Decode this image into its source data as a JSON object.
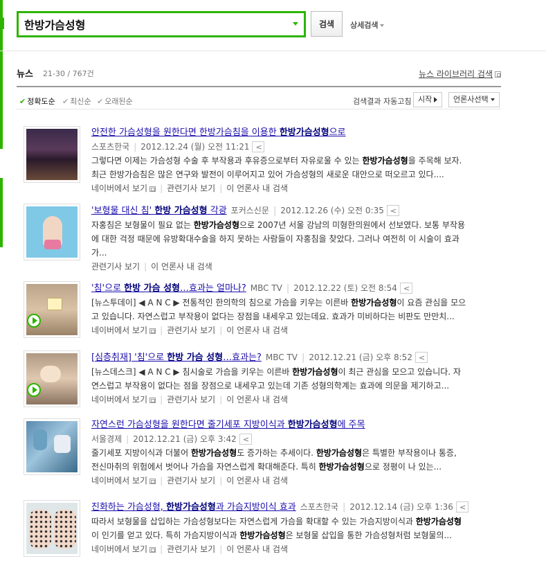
{
  "header": {
    "query": "한방가슴성형",
    "search_button": "검색",
    "advanced_search": "상세검색"
  },
  "section": {
    "title": "뉴스",
    "count": "21-30 / 767건",
    "library_link": "뉴스 라이브러리 검색"
  },
  "sort": {
    "options": [
      "정확도순",
      "최신순",
      "오래된순"
    ],
    "auto_label": "검색결과 자동고침",
    "start_button": "시작",
    "press_select": "언론사선택"
  },
  "colors": {
    "brand_green": "#2db400",
    "link_blue": "#1a0dab"
  },
  "results": [
    {
      "title_pre": "안전한 가슴성형을 원한다면 한방가슴침을 이용한 ",
      "title_hl": "한방가슴성형",
      "title_post": "으로",
      "press": "스포츠한국",
      "date": "2012.12.24 (월) 오전 11:21",
      "desc1_a": "그렇다면 이제는 가슴성형 수술 후 부작용과 후유증으로부터 자유로울 수 있는 ",
      "desc1_hl": "한방가슴성형",
      "desc1_b": "을 주목해 보자.",
      "desc2": "최근 한방가슴침은 많은 연구와 발전이 이루어지고 있어 가슴성형의 새로운 대안으로 떠오르고 있다....",
      "link_naver": "네이버에서 보기",
      "link_related": "관련기사 보기",
      "link_press": "이 언론사 내 검색"
    },
    {
      "title_pre": "'보형물 대신 침' ",
      "title_hl": "한방 가슴성형",
      "title_post": " 각광",
      "press": "포커스신문",
      "date": "2012.12.26 (수) 오전 0:35",
      "desc1_a": "자홍침은 보형물이 필요 없는 ",
      "desc1_hl": "한방가슴성형",
      "desc1_b": "으로 2007년 서울 강남의 미형한의원에서 선보였다. 보통 부작용",
      "desc2": "에 대한 걱정 때문에 유방확대수술을 하지 못하는 사람들이 자홍침을 찾았다. 그러나 여전히 이 시술이 효과",
      "desc3": "가...",
      "link_related": "관련기사 보기",
      "link_press": "이 언론사 내 검색"
    },
    {
      "title_pre": "'침'으로 ",
      "title_hl": "한방 가슴 성형",
      "title_post": "…효과는 얼마나?",
      "press": "MBC TV",
      "date": "2012.12.22 (토) 오전 8:54",
      "desc1_a": "[뉴스투데이] ◀ A N C ▶ 전통적인 한의학의 침으로 가슴을 키우는 이른바 ",
      "desc1_hl": "한방가슴성형",
      "desc1_b": "이 요즘 관심을 모으",
      "desc2": "고 있습니다. 자연스럽고 부작용이 없다는 장점을 내세우고 있는데요. 효과가 미비하다는 비판도 만만치...",
      "link_naver": "네이버에서 보기",
      "link_related": "관련기사 보기",
      "link_press": "이 언론사 내 검색"
    },
    {
      "title_pre": "[심층취재] '침'으로 ",
      "title_hl": "한방 가슴 성형",
      "title_post": "…효과는?",
      "press": "MBC TV",
      "date": "2012.12.21 (금) 오후 8:52",
      "desc1_a": "[뉴스데스크] ◀ A N C ▶ 침시술로 가슴을 키우는 이른바 ",
      "desc1_hl": "한방가슴성형",
      "desc1_b": "이 최근 관심을 모으고 있습니다. 자",
      "desc2": "연스럽고 부작용이 없다는 점을 장점으로 내세우고 있는데 기존 성형의학계는 효과에 의문을 제기하고...",
      "link_naver": "네이버에서 보기",
      "link_related": "관련기사 보기",
      "link_press": "이 언론사 내 검색"
    },
    {
      "title_pre": "자연스런 가슴성형을 원한다면 줄기세포 지방이식과 ",
      "title_hl": "한방가슴성형",
      "title_post": "에 주목",
      "press": "서울경제",
      "date": "2012.12.21 (금) 오후 3:42",
      "desc1_a": "줄기세포 지방이식과 더불어 ",
      "desc1_hl": "한방가슴성형",
      "desc1_b": "도 증가하는 추세이다. ",
      "desc1_hl2": "한방가슴성형",
      "desc1_c": "은 특별한 부작용이나 통증,",
      "desc2_a": "전신마취의 위험에서 벗어나 가슴을 자연스럽게 확대해준다. 특히 ",
      "desc2_hl": "한방가슴성형",
      "desc2_b": "으로 정평이 나 있는...",
      "link_naver": "네이버에서 보기",
      "link_related": "관련기사 보기",
      "link_press": "이 언론사 내 검색"
    },
    {
      "title_pre": "진화하는 가슴성형, ",
      "title_hl": "한방가슴성형",
      "title_post": "과 가슴지방이식 효과",
      "press": "스포츠한국",
      "date": "2012.12.14 (금) 오후 1:36",
      "desc1_a": "따라서 보형물을 삽입하는 가슴성형보다는 자연스럽게 가슴을 확대할 수 있는 가슴지방이식과 ",
      "desc1_hl": "한방가슴성형",
      "desc1_b": "",
      "desc2_a": "이 인기를 얻고 있다. 특히 가슴지방이식과 ",
      "desc2_hl": "한방가슴성형",
      "desc2_b": "은 보형물 삽입을 통한 가슴성형처럼 보형물의...",
      "link_naver": "네이버에서 보기",
      "link_related": "관련기사 보기",
      "link_press": "이 언론사 내 검색"
    }
  ]
}
